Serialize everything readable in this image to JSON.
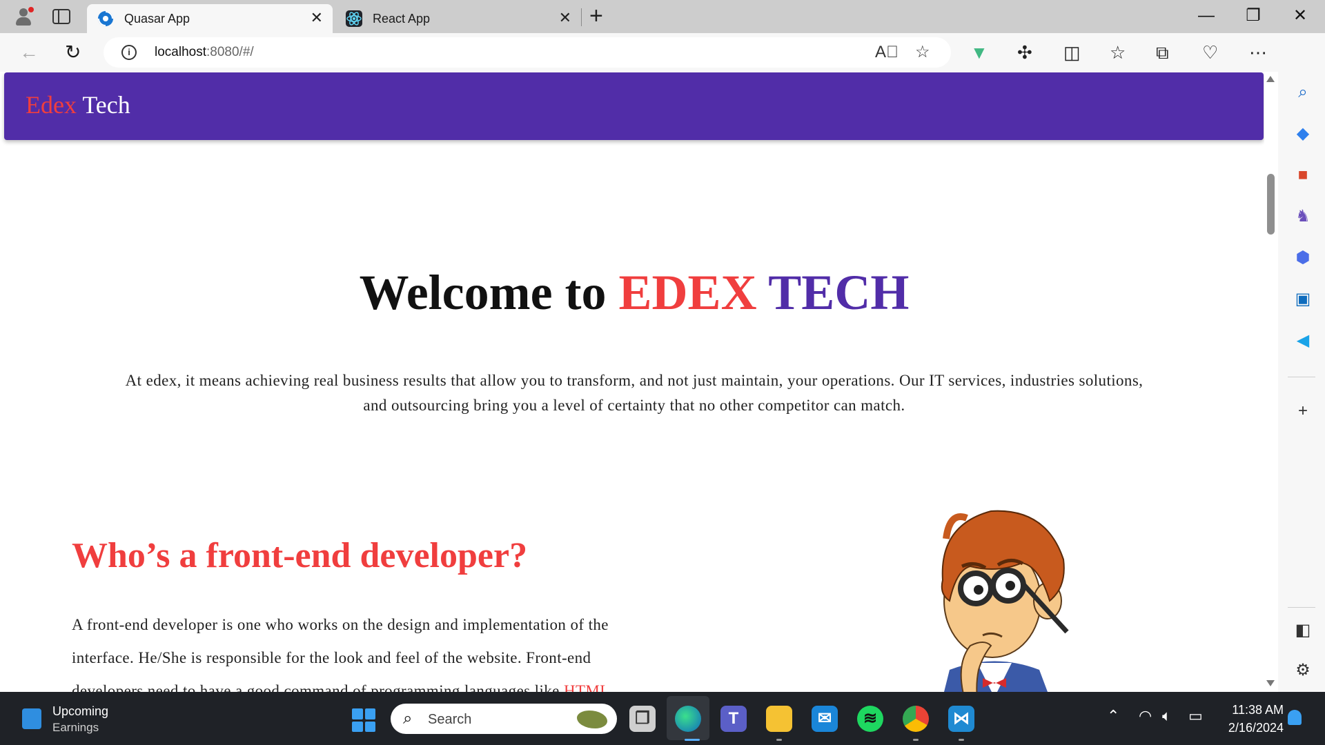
{
  "browser": {
    "tabs": [
      {
        "title": "Quasar App",
        "active": true,
        "icon": "quasar-icon"
      },
      {
        "title": "React App",
        "active": false,
        "icon": "react-icon"
      }
    ],
    "close_glyph": "✕",
    "new_tab_glyph": "+",
    "url_host": "localhost",
    "url_rest": ":8080/#/",
    "window_controls": {
      "minimize": "—",
      "restore": "❐",
      "close": "✕"
    }
  },
  "app": {
    "brand_part1": "Edex",
    "brand_part2": "Tech",
    "hero": {
      "title_prefix": "Welcome to",
      "title_edex": "EDEX",
      "title_tech": "TECH",
      "text": "At edex, it means achieving real business results that allow you to transform, and not just maintain, your operations. Our IT services, industries solutions, and outsourcing bring you a level of certainty that no other competitor can match."
    },
    "section": {
      "title": "Who’s a front-end developer?",
      "text": "A front-end developer is one who works on the design and implementation of the interface. He/She is responsible for the look and feel of the website. Front-end developers need to have a good command of programming languages like",
      "highlight": "HTML,"
    }
  },
  "taskbar": {
    "weather_title": "Upcoming",
    "weather_sub": "Earnings",
    "search_label": "Search",
    "time": "11:38 AM",
    "date": "2/16/2024"
  },
  "colors": {
    "brand_purple": "#512da8",
    "accent_red": "#f03e3e",
    "taskbar": "#1f2227"
  }
}
